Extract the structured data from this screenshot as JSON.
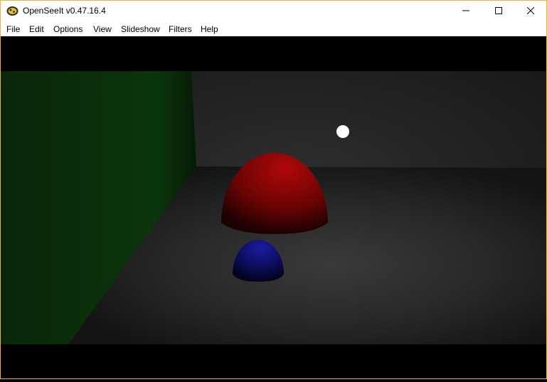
{
  "window": {
    "title": "OpenSeeIt v0.47.16.4"
  },
  "menu": {
    "items": [
      "File",
      "Edit",
      "Options",
      "View",
      "Slideshow",
      "Filters",
      "Help"
    ]
  },
  "controls": {
    "minimize_icon": "minimize-icon",
    "maximize_icon": "maximize-icon",
    "close_icon": "close-icon"
  },
  "colors": {
    "accent_border": "#e8b43a",
    "red_sphere": "#a00000",
    "blue_sphere": "#1a1a8c",
    "green_wall": "#0b3a0b"
  },
  "image": {
    "description_icon": "rendered-scene-image"
  }
}
